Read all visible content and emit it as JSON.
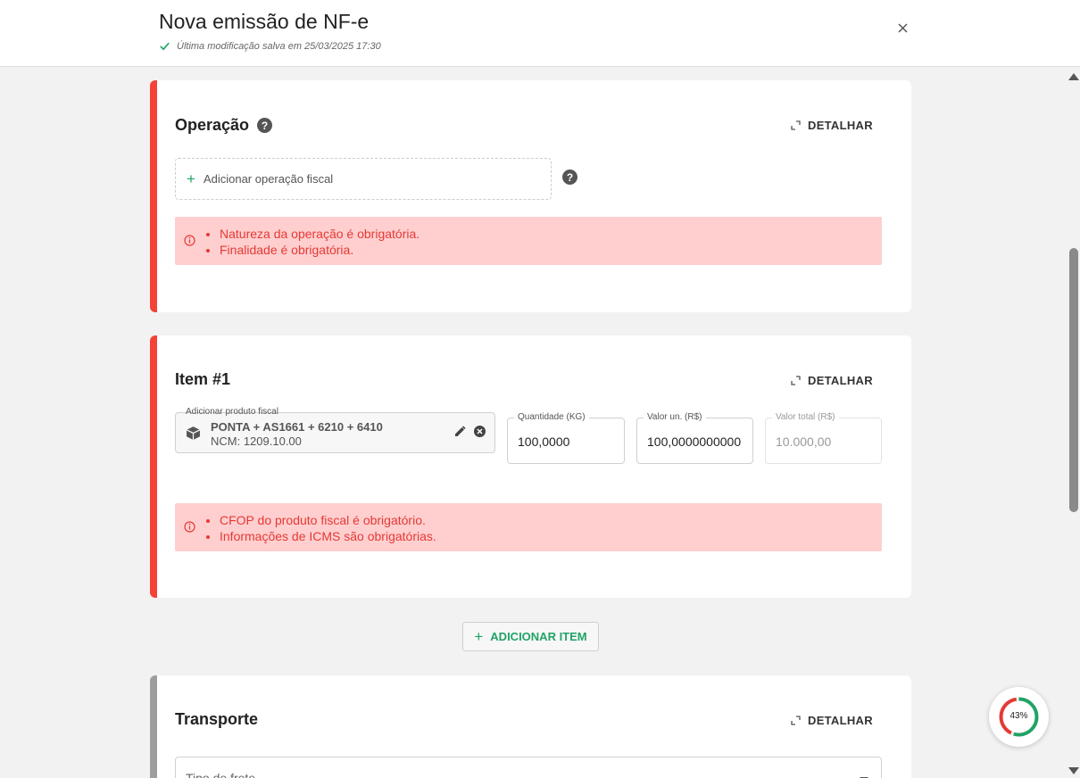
{
  "header": {
    "title": "Nova emissão de NF-e",
    "saved_status": "Última modificação salva em 25/03/2025 17:30"
  },
  "operacao": {
    "title": "Operação",
    "detail_label": "DETALHAR",
    "add_placeholder": "Adicionar operação fiscal",
    "errors": [
      "Natureza da operação é obrigatória.",
      "Finalidade é obrigatória."
    ]
  },
  "item": {
    "title": "Item #1",
    "detail_label": "DETALHAR",
    "product_label": "Adicionar produto fiscal",
    "product_name": "PONTA + AS1661 + 6210 + 6410",
    "product_ncm": "NCM: 1209.10.00",
    "quantidade_label": "Quantidade (KG)",
    "quantidade_value": "100,0000",
    "valor_un_label": "Valor un. (R$)",
    "valor_un_value": "100,0000000000",
    "valor_total_label": "Valor total (R$)",
    "valor_total_value": "10.000,00",
    "errors": [
      "CFOP do produto fiscal é obrigatório.",
      "Informações de ICMS são obrigatórias."
    ]
  },
  "add_item_label": "ADICIONAR ITEM",
  "transporte": {
    "title": "Transporte",
    "detail_label": "DETALHAR",
    "tipo_frete_label": "Tipo de frete"
  },
  "progress": {
    "value": 43,
    "label": "43%"
  },
  "colors": {
    "error_accent": "#f44336",
    "neutral_accent": "#9e9e9e",
    "green": "#21a366",
    "error_bg": "#ffcfcf"
  }
}
